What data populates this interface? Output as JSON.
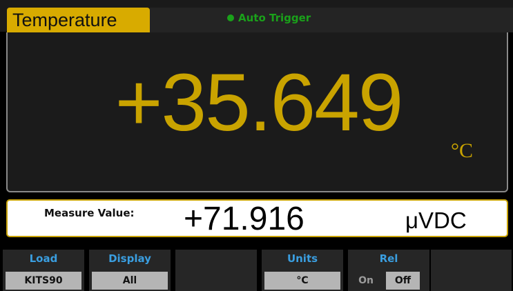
{
  "header": {
    "mode_tab": "Temperature",
    "trigger_status": "Auto Trigger",
    "trigger_color": "#1aa11a"
  },
  "main_display": {
    "value": "+35.649",
    "unit": "°C",
    "value_color": "#c9a300"
  },
  "secondary_display": {
    "label": "Measure Value:",
    "value": "+71.916",
    "unit": "μVDC"
  },
  "softkeys": [
    {
      "label": "Load",
      "value": "KITS90"
    },
    {
      "label": "Display",
      "value": "All"
    },
    {
      "label": "",
      "value": ""
    },
    {
      "label": "Units",
      "value": "°C"
    },
    {
      "label": "Rel",
      "options": [
        "On",
        "Off"
      ],
      "selected": "Off"
    },
    {
      "label": "",
      "value": ""
    }
  ],
  "colors": {
    "label_blue": "#3a9ee0",
    "tab_gold": "#d8ab00",
    "key_bg": "#262626",
    "value_bg": "#b5b5b5"
  }
}
